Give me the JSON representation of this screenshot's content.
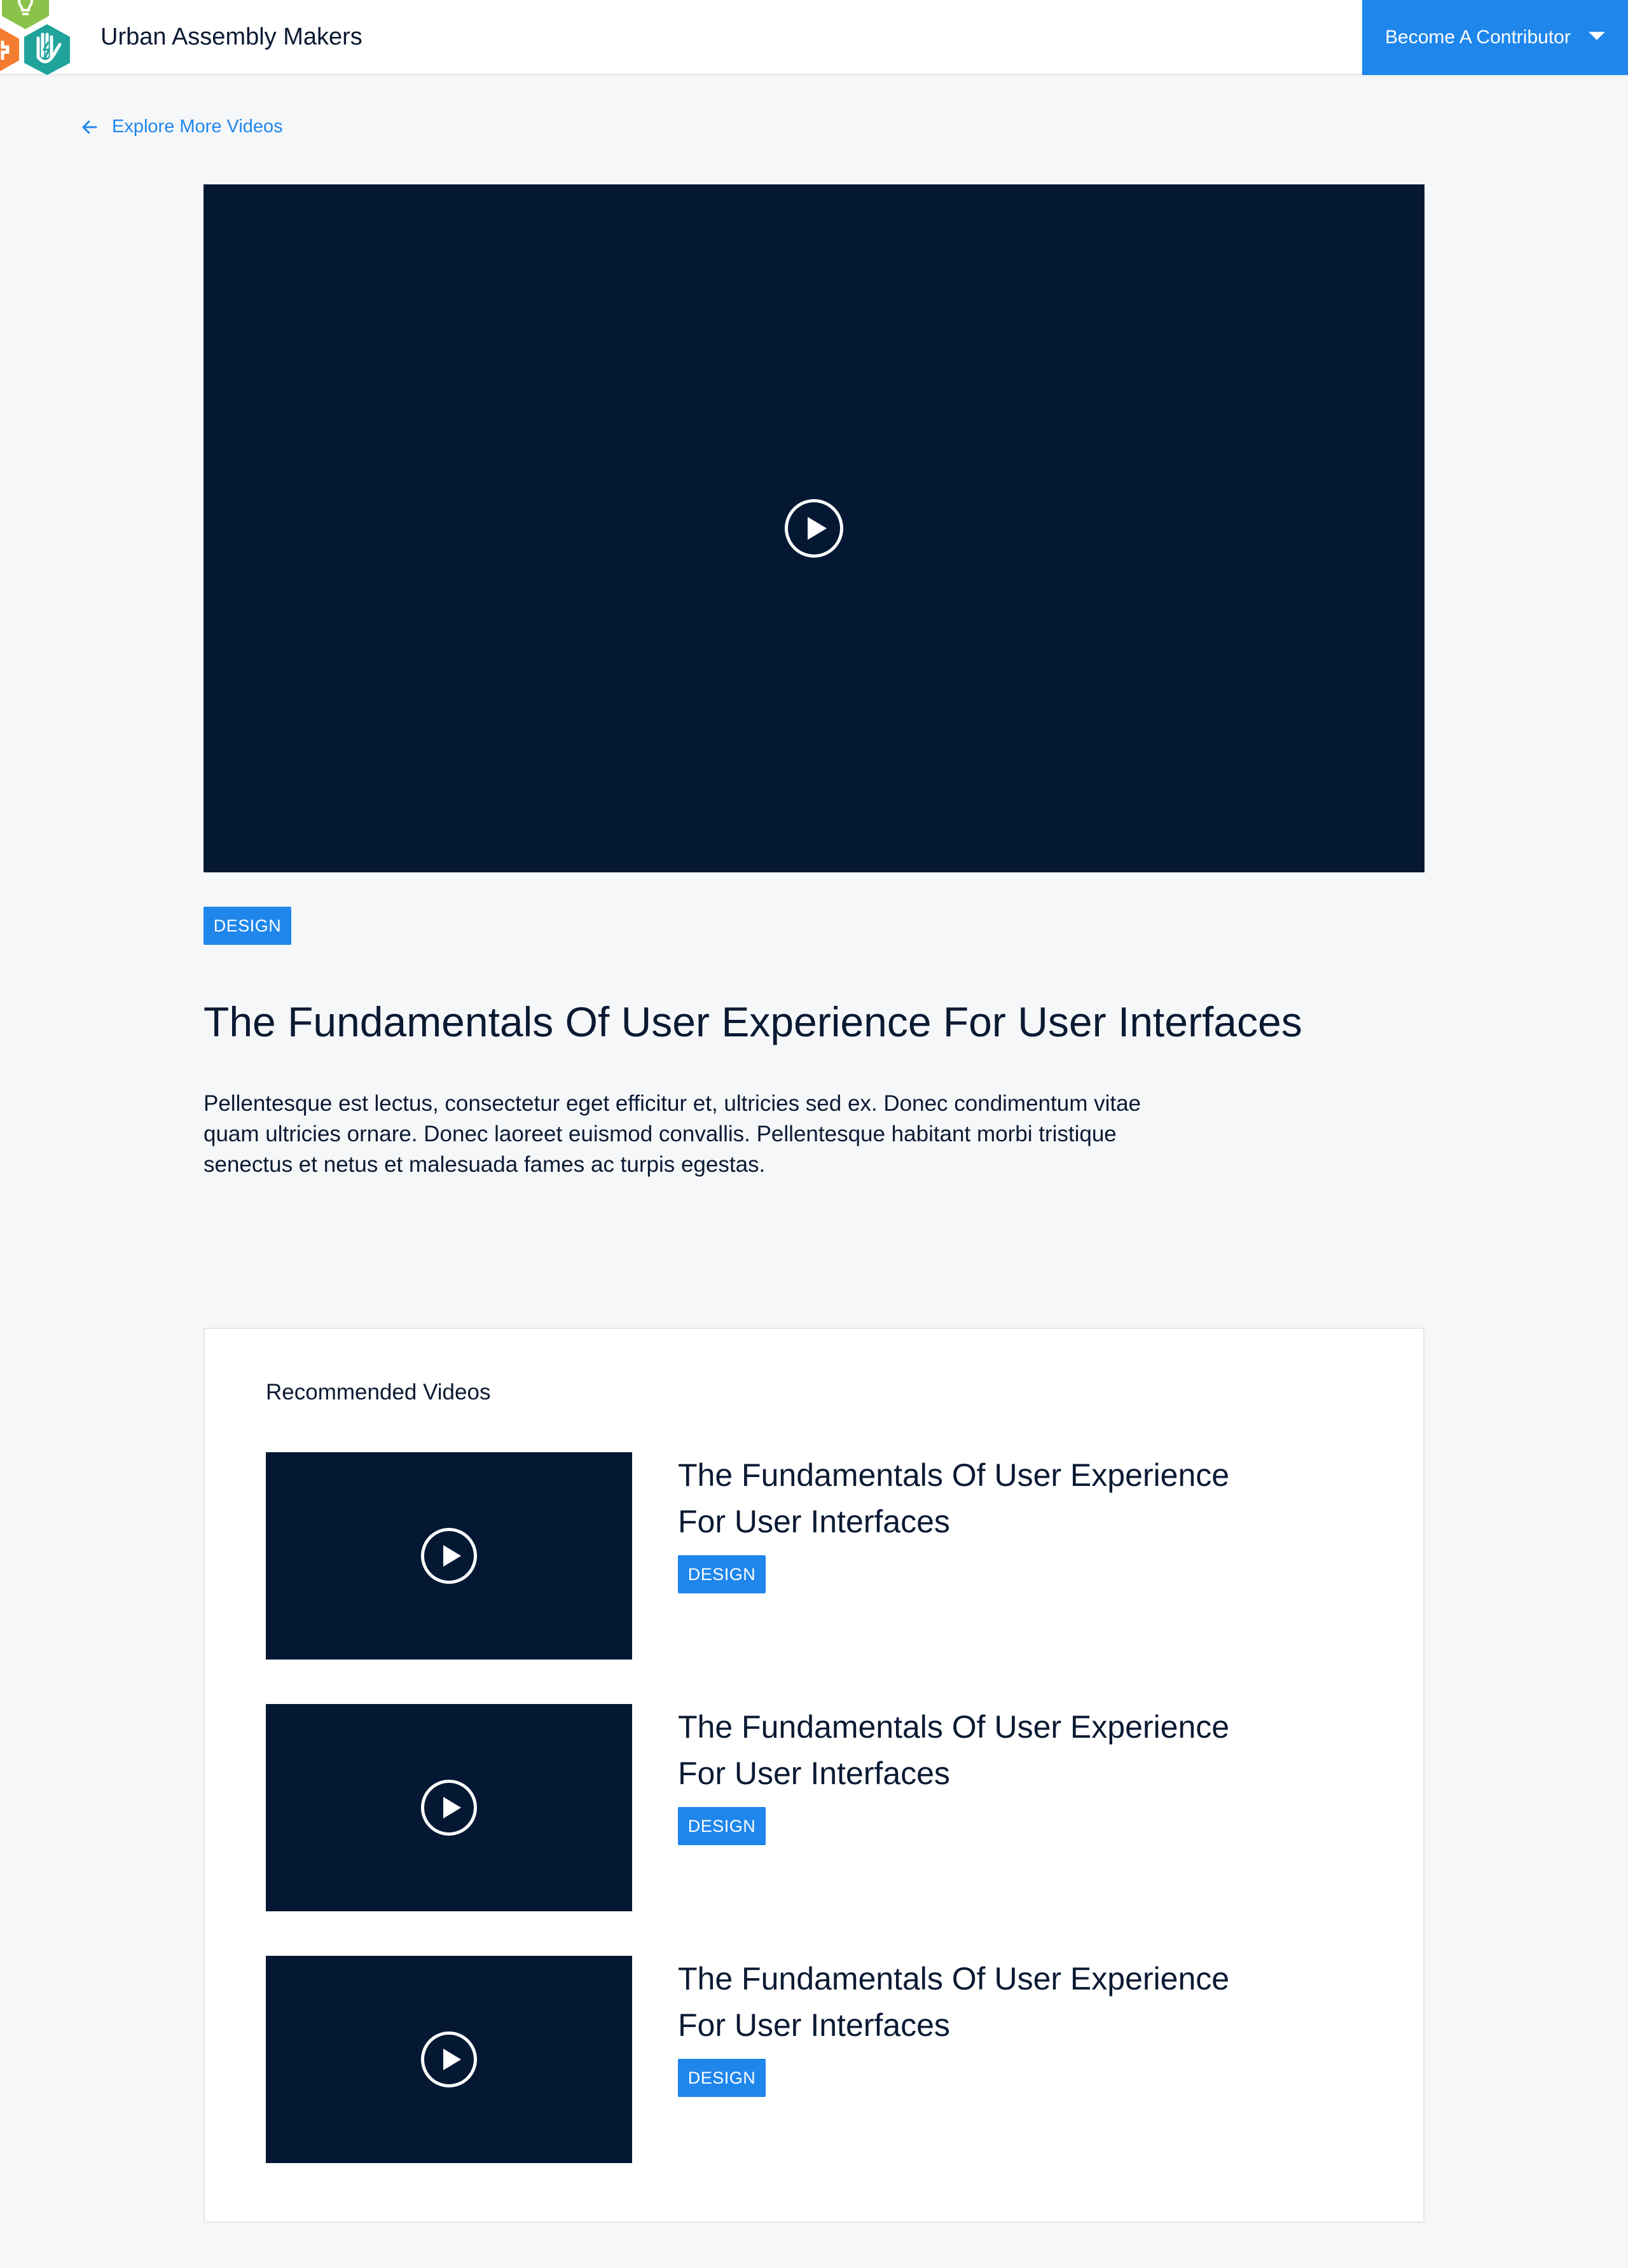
{
  "header": {
    "brand": "Urban Assembly Makers",
    "contributor_button": "Become A Contributor",
    "logo_colors": [
      "#8bc34a",
      "#f47c30",
      "#1fa39a"
    ]
  },
  "back_link": {
    "label": "Explore More Videos"
  },
  "video": {
    "tag": "DESIGN",
    "title": "The Fundamentals Of User Experience For User Interfaces",
    "description": "Pellentesque est lectus, consectetur eget efficitur et, ultricies sed ex. Donec condimentum vitae quam ultricies ornare. Donec laoreet euismod convallis. Pellentesque habitant morbi tristique senectus et netus et malesuada fames ac turpis egestas."
  },
  "recommended": {
    "heading": "Recommended Videos",
    "items": [
      {
        "title": "The Fundamentals Of User Experience For User Interfaces",
        "tag": "DESIGN"
      },
      {
        "title": "The Fundamentals Of User Experience For User Interfaces",
        "tag": "DESIGN"
      },
      {
        "title": "The Fundamentals Of User Experience For User Interfaces",
        "tag": "DESIGN"
      }
    ]
  },
  "colors": {
    "accent": "#1f86ec",
    "video_bg": "#041833",
    "page_bg": "#f6f7f9"
  },
  "icons": {
    "back": "arrow-left-icon",
    "caret": "caret-down-icon",
    "play": "play-icon"
  }
}
